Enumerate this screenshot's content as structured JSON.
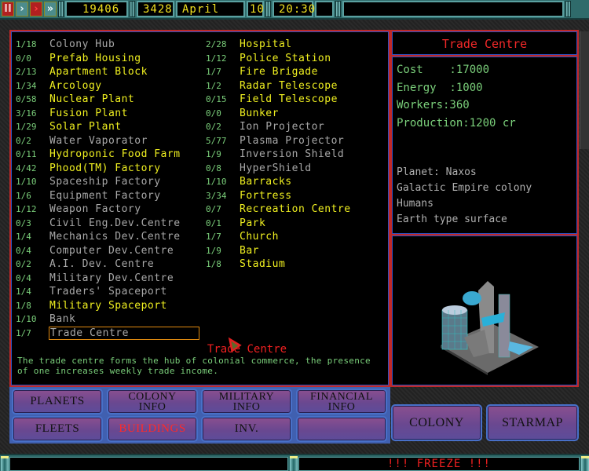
{
  "topbar": {
    "controls": [
      {
        "name": "pause",
        "glyph": "II"
      },
      {
        "name": "play",
        "glyph": "›"
      },
      {
        "name": "fast",
        "glyph": "›"
      },
      {
        "name": "faster",
        "glyph": "»"
      }
    ],
    "credits": "19406",
    "year": "3428",
    "month": "April",
    "day": "10",
    "time": "20:30"
  },
  "buildings": {
    "column1": [
      {
        "count": "1/18",
        "name": "Colony Hub",
        "color": "grey"
      },
      {
        "count": "0/0",
        "name": "Prefab Housing",
        "color": "yellow"
      },
      {
        "count": "2/13",
        "name": "Apartment Block",
        "color": "yellow"
      },
      {
        "count": "1/34",
        "name": "Arcology",
        "color": "yellow"
      },
      {
        "count": "0/58",
        "name": "Nuclear Plant",
        "color": "yellow"
      },
      {
        "count": "3/16",
        "name": "Fusion Plant",
        "color": "yellow"
      },
      {
        "count": "1/29",
        "name": "Solar Plant",
        "color": "yellow"
      },
      {
        "count": "0/2",
        "name": "Water Vaporator",
        "color": "grey"
      },
      {
        "count": "0/11",
        "name": "Hydroponic Food Farm",
        "color": "yellow"
      },
      {
        "count": "4/42",
        "name": "Phood(TM) Factory",
        "color": "yellow"
      },
      {
        "count": "1/10",
        "name": "Spaceship Factory",
        "color": "grey"
      },
      {
        "count": "1/6",
        "name": "Equipment Factory",
        "color": "grey"
      },
      {
        "count": "1/12",
        "name": "Weapon Factory",
        "color": "grey"
      },
      {
        "count": "0/3",
        "name": "Civil Eng.Dev.Centre",
        "color": "grey"
      },
      {
        "count": "1/4",
        "name": "Mechanics Dev.Centre",
        "color": "grey"
      },
      {
        "count": "0/4",
        "name": "Computer Dev.Centre",
        "color": "grey"
      },
      {
        "count": "0/2",
        "name": "A.I. Dev. Centre",
        "color": "grey"
      },
      {
        "count": "0/4",
        "name": "Military Dev.Centre",
        "color": "grey"
      },
      {
        "count": "1/4",
        "name": "Traders' Spaceport",
        "color": "grey"
      },
      {
        "count": "1/8",
        "name": "Military Spaceport",
        "color": "yellow"
      },
      {
        "count": "1/10",
        "name": "Bank",
        "color": "grey"
      },
      {
        "count": "1/7",
        "name": "Trade Centre",
        "color": "grey",
        "selected": true
      }
    ],
    "column2": [
      {
        "count": "2/28",
        "name": "Hospital",
        "color": "yellow"
      },
      {
        "count": "1/12",
        "name": "Police Station",
        "color": "yellow"
      },
      {
        "count": "1/7",
        "name": "Fire Brigade",
        "color": "yellow"
      },
      {
        "count": "1/2",
        "name": "Radar Telescope",
        "color": "yellow"
      },
      {
        "count": "0/15",
        "name": "Field Telescope",
        "color": "yellow"
      },
      {
        "count": "0/0",
        "name": "Bunker",
        "color": "yellow"
      },
      {
        "count": "0/2",
        "name": "Ion Projector",
        "color": "grey"
      },
      {
        "count": "5/77",
        "name": "Plasma Projector",
        "color": "grey"
      },
      {
        "count": "1/9",
        "name": "Inversion Shield",
        "color": "grey"
      },
      {
        "count": "0/8",
        "name": "HyperShield",
        "color": "grey"
      },
      {
        "count": "1/10",
        "name": "Barracks",
        "color": "yellow"
      },
      {
        "count": "3/34",
        "name": "Fortress",
        "color": "yellow"
      },
      {
        "count": "0/7",
        "name": "Recreation Centre",
        "color": "yellow"
      },
      {
        "count": "0/1",
        "name": "Park",
        "color": "yellow"
      },
      {
        "count": "1/7",
        "name": "Church",
        "color": "yellow"
      },
      {
        "count": "1/9",
        "name": "Bar",
        "color": "yellow"
      },
      {
        "count": "1/8",
        "name": "Stadium",
        "color": "yellow"
      }
    ]
  },
  "description": {
    "title": "Trade Centre",
    "text": "The trade centre forms the hub of colonial commerce, the presence of one increases weekly trade income."
  },
  "details": {
    "title": "Trade Centre",
    "cost": "Cost    :17000",
    "energy": "Energy  :1000",
    "workers": "Workers:360",
    "production": "Production:1200 cr",
    "planet": "Planet: Naxos",
    "owner": "Galactic Empire colony",
    "race": "Humans",
    "surface": "Earth type surface"
  },
  "nav": {
    "planets": "PLANETS",
    "colony_info": [
      "COLONY",
      "INFO"
    ],
    "military_info": [
      "MILITARY",
      "INFO"
    ],
    "financial_info": [
      "FINANCIAL",
      "INFO"
    ],
    "fleets": "FLEETS",
    "buildings": "BUILDINGS",
    "inv": "INV.",
    "empty": "",
    "colony": "COLONY",
    "starmap": "STARMAP"
  },
  "status": {
    "message": "",
    "freeze": "!!! FREEZE !!!"
  },
  "colors": {
    "accent_red": "#f02020",
    "list_yellow": "#f0f020",
    "list_grey": "#a8a8a8",
    "count_green": "#7bd07b",
    "selection_orange": "#e08a10"
  }
}
